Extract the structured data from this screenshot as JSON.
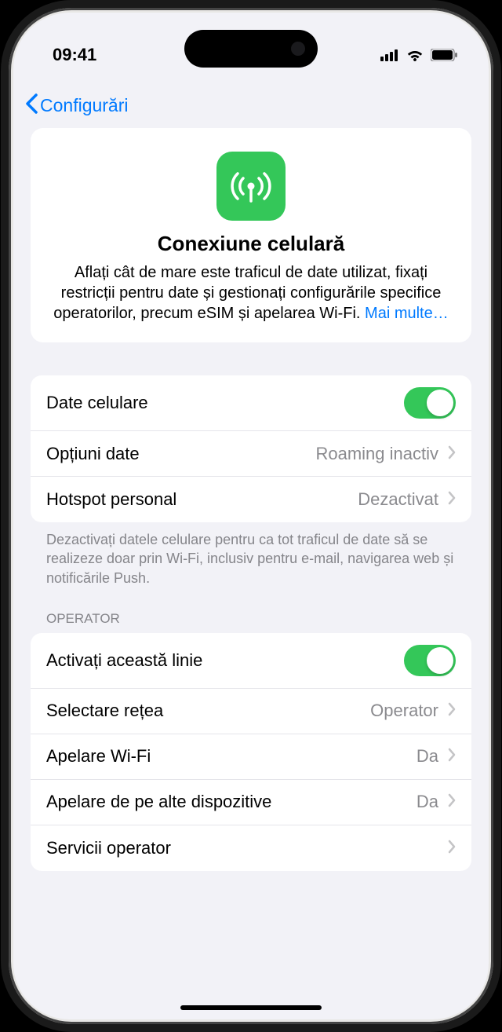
{
  "status": {
    "time": "09:41"
  },
  "nav": {
    "back_label": "Configurări"
  },
  "hero": {
    "title": "Conexiune celulară",
    "description": "Aflați cât de mare este traficul de date utilizat, fixați restricții pentru date și gestionați configurările specifice operatorilor, precum eSIM și apelarea Wi-Fi. ",
    "link_text": "Mai multe…"
  },
  "group1": {
    "cellular_data_label": "Date celulare",
    "data_options_label": "Opțiuni date",
    "data_options_value": "Roaming inactiv",
    "hotspot_label": "Hotspot personal",
    "hotspot_value": "Dezactivat"
  },
  "group1_footer": "Dezactivați datele celulare pentru ca tot traficul de date să se realizeze doar prin Wi-Fi, inclusiv pentru e-mail, navigarea web și notificările Push.",
  "section2_header": "OPERATOR",
  "group2": {
    "activate_line_label": "Activați această linie",
    "network_label": "Selectare rețea",
    "network_value": "Operator",
    "wifi_calling_label": "Apelare Wi-Fi",
    "wifi_calling_value": "Da",
    "other_devices_label": "Apelare de pe alte dispozitive",
    "other_devices_value": "Da",
    "carrier_services_label": "Servicii operator"
  }
}
